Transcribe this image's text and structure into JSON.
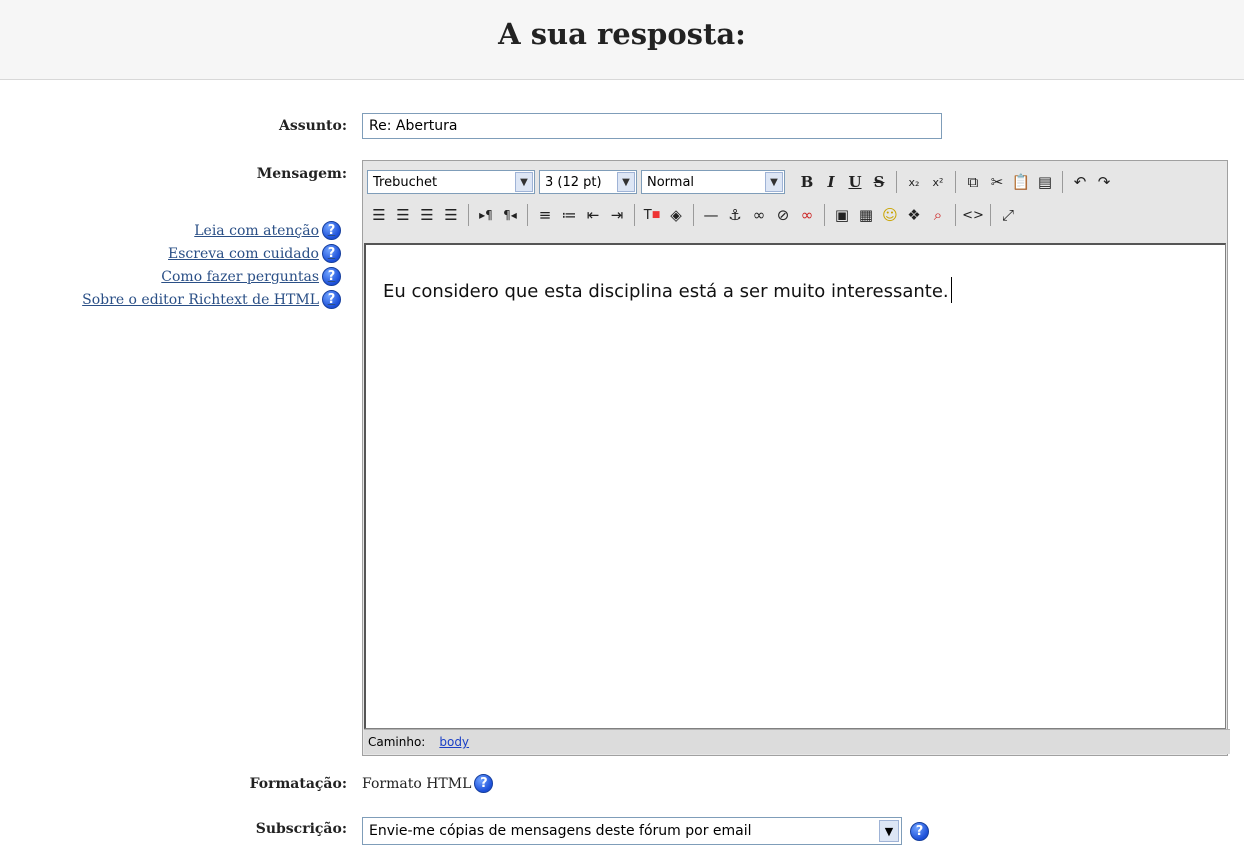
{
  "page_title": "A sua resposta:",
  "form": {
    "subject_label": "Assunto:",
    "subject_value": "Re: Abertura",
    "message_label": "Mensagem:",
    "format_label": "Formatação:",
    "format_value": "Formato HTML",
    "subscription_label": "Subscrição:",
    "subscription_value": "Envie-me cópias de mensagens deste fórum por email"
  },
  "help_links": [
    {
      "label": "Leia com atenção",
      "icon": "help-icon"
    },
    {
      "label": "Escreva com cuidado",
      "icon": "help-icon"
    },
    {
      "label": "Como fazer perguntas",
      "icon": "help-icon"
    },
    {
      "label": "Sobre o editor Richtext de HTML",
      "icon": "help-icon"
    }
  ],
  "editor": {
    "font_select": "Trebuchet",
    "size_select": "3 (12 pt)",
    "style_select": "Normal",
    "content": "Eu considero que esta disciplina está a ser muito interessante.",
    "status_label": "Caminho:",
    "status_path": "body"
  }
}
